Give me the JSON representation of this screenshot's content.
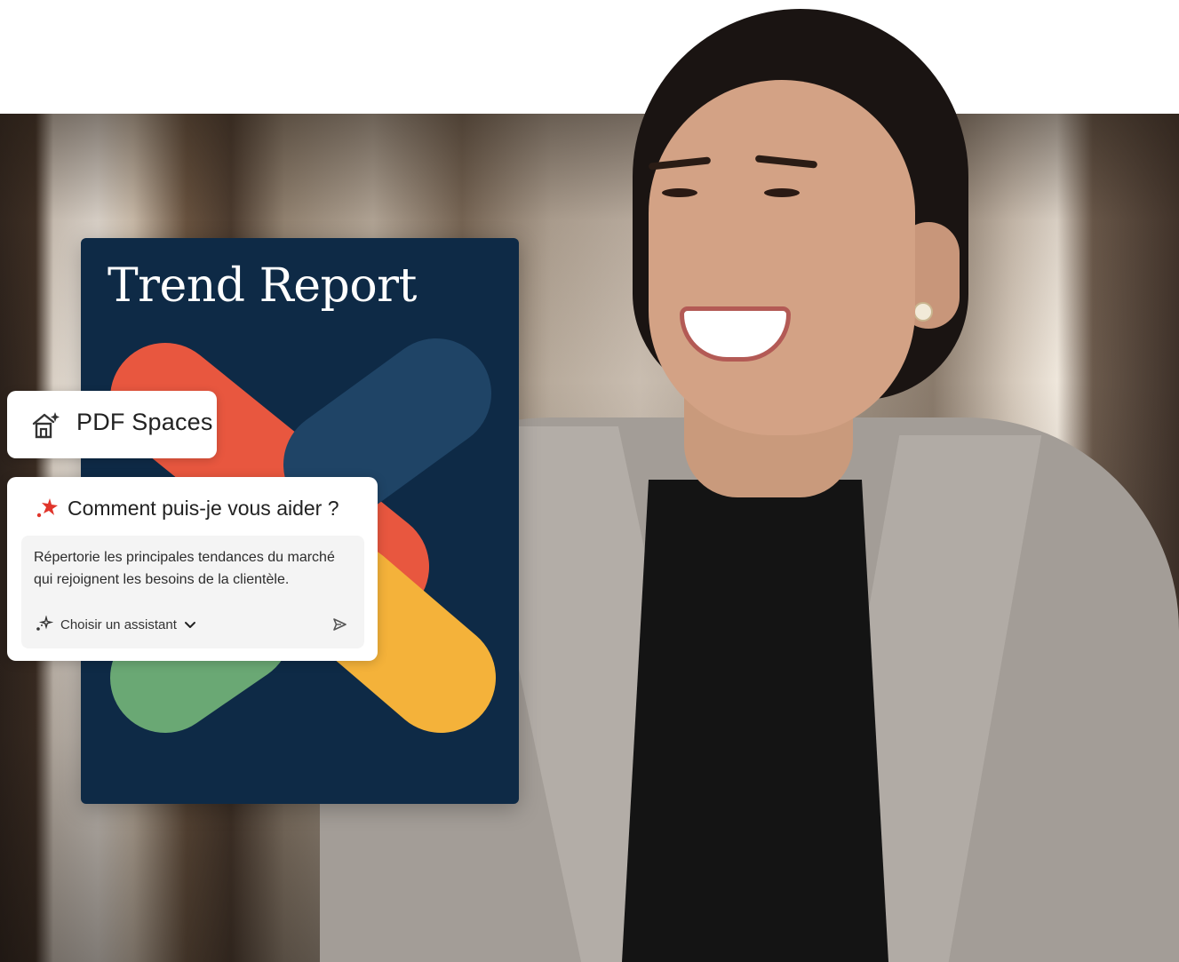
{
  "report": {
    "title": "Trend Report"
  },
  "pdf_spaces": {
    "label": "PDF Spaces"
  },
  "assistant": {
    "question": "Comment puis-je vous aider ?",
    "prompt_line1": "Répertorie les principales tendances du marché",
    "prompt_line2": "qui rejoignent les besoins de la clientèle.",
    "chooser_label": "Choisir un assistant"
  },
  "icons": {
    "pdf_spaces": "house-sparkle-icon",
    "question": "ai-sparkle-icon",
    "chooser": "sparkles-icon",
    "dropdown": "chevron-down-icon",
    "send": "send-icon"
  },
  "colors": {
    "report_bg": "#0e2a46",
    "shape_red": "#e8573f",
    "shape_blue": "#1f4466",
    "shape_yellow": "#f4b23a",
    "shape_green": "#6aa874",
    "accent_red": "#e0352b"
  }
}
